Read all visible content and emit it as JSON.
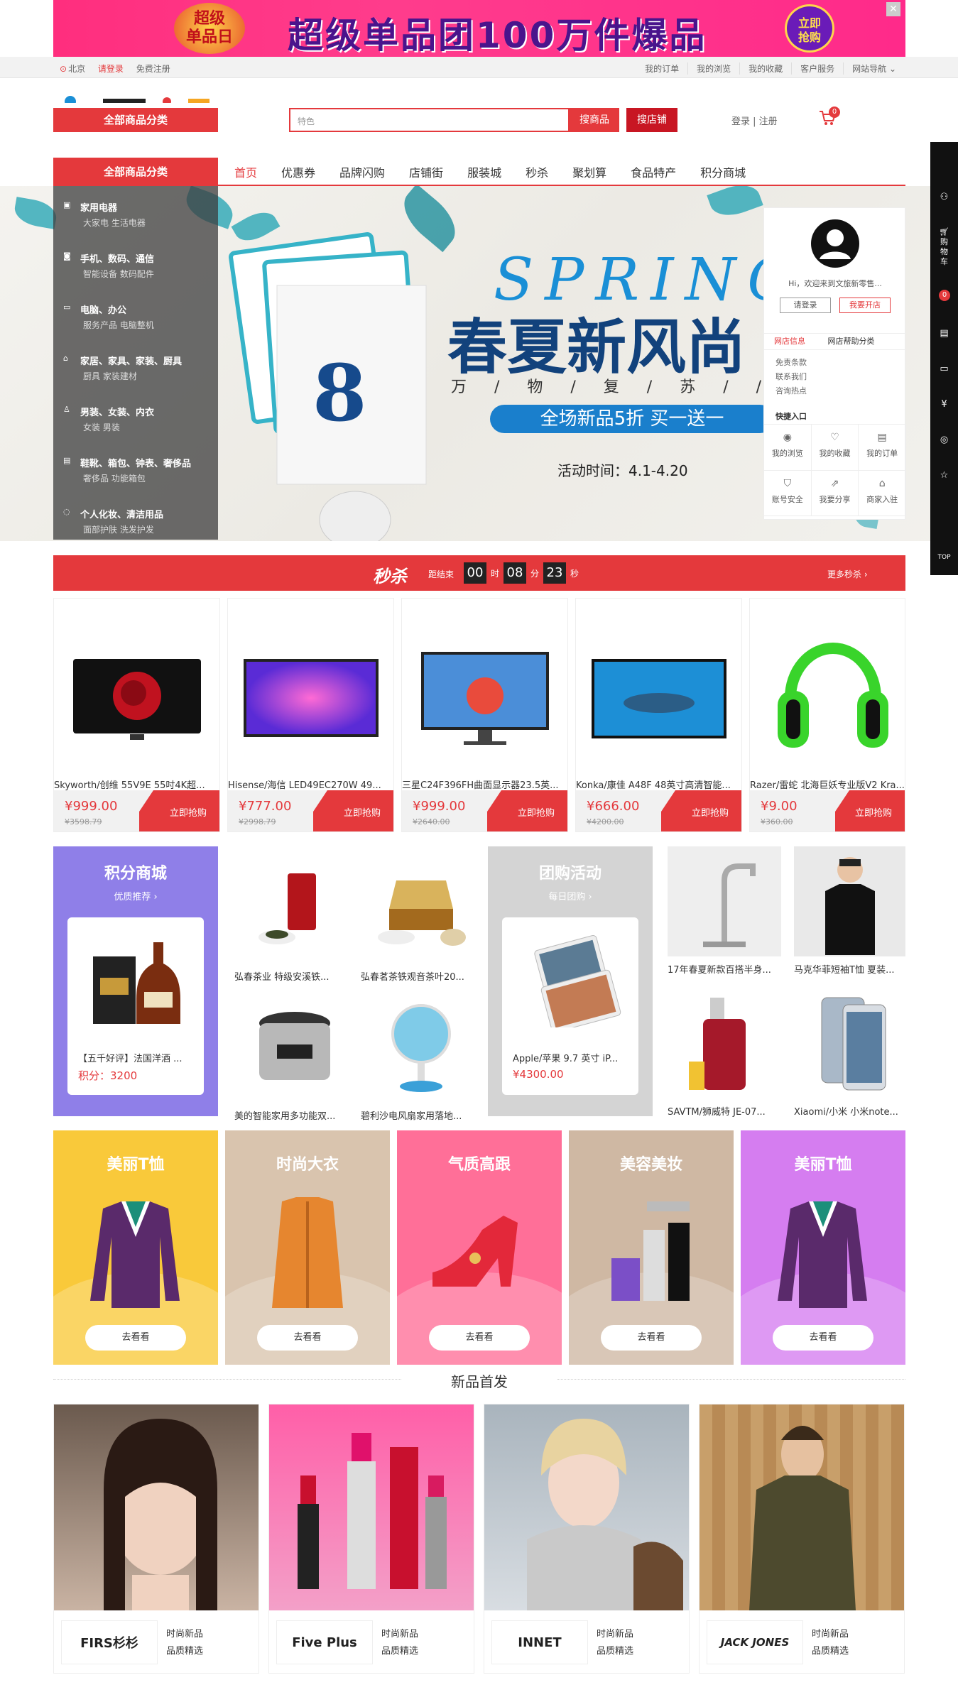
{
  "top_ad": {
    "badge_line1": "超级",
    "badge_line2": "单品日",
    "slogan": "超级单品团100万件爆品",
    "cta_line1": "立即",
    "cta_line2": "抢购",
    "close": "✕"
  },
  "toolbar": {
    "location": "北京",
    "login": "请登录",
    "register": "免费注册",
    "links": [
      "我的订单",
      "我的浏览",
      "我的收藏",
      "客户服务",
      "网站导航 ⌄"
    ]
  },
  "header": {
    "all_categories": "全部商品分类",
    "search_placeholder": "特色",
    "search_products": "搜商品",
    "search_shops": "搜店铺",
    "login_register": "登录 | 注册",
    "cart_count": "0"
  },
  "nav": {
    "all_categories": "全部商品分类",
    "links": [
      "首页",
      "优惠券",
      "品牌闪购",
      "店铺街",
      "服装城",
      "秒杀",
      "聚划算",
      "食品特产",
      "积分商城"
    ]
  },
  "categories": [
    {
      "title": "家用电器",
      "sub": "大家电  生活电器"
    },
    {
      "title": "手机、数码、通信",
      "sub": "智能设备  数码配件"
    },
    {
      "title": "电脑、办公",
      "sub": "服务产品  电脑整机"
    },
    {
      "title": "家居、家具、家装、厨具",
      "sub": "厨具  家装建材"
    },
    {
      "title": "男装、女装、内衣",
      "sub": "女装  男装"
    },
    {
      "title": "鞋靴、箱包、钟表、奢侈品",
      "sub": "奢侈品  功能箱包"
    },
    {
      "title": "个人化妆、清洁用品",
      "sub": "面部护肤  洗发护发"
    }
  ],
  "banner": {
    "spring": "SPRING",
    "title": "春夏新风尚",
    "subtitle": "万 / 物 / 复 / 苏 / / 的 季",
    "promo": "全场新品5折 买一送一",
    "date": "活动时间：4.1-4.20"
  },
  "user_card": {
    "greeting": "Hi，欢迎来到文旅新零售...",
    "login": "请登录",
    "open_shop": "我要开店",
    "tab1": "网店信息",
    "tab2": "网店帮助分类",
    "notices": [
      "免责条款",
      "联系我们",
      "咨询热点"
    ],
    "quick_title": "快捷入口",
    "quick": [
      "我的浏览",
      "我的收藏",
      "我的订单",
      "账号安全",
      "我要分享",
      "商家入驻"
    ]
  },
  "sidebar": {
    "cart": "购物车",
    "cart_count": "0",
    "top": "TOP"
  },
  "seckill": {
    "title": "秒杀",
    "countdown_label": "距结束",
    "hh": "00",
    "mm": "08",
    "ss": "23",
    "u_h": "时",
    "u_m": "分",
    "u_s": "秒",
    "more": "更多秒杀 ›"
  },
  "products": [
    {
      "name": "Skyworth/创维 55V9E 55吋4K超...",
      "price": "¥999.00",
      "old": "¥3598.79",
      "buy": "立即抢购"
    },
    {
      "name": "Hisense/海信 LED49EC270W 49...",
      "price": "¥777.00",
      "old": "¥2998.79",
      "buy": "立即抢购"
    },
    {
      "name": "三星C24F396FH曲面显示器23.5英...",
      "price": "¥999.00",
      "old": "¥2640.00",
      "buy": "立即抢购"
    },
    {
      "name": "Konka/康佳 A48F 48英寸高清智能...",
      "price": "¥666.00",
      "old": "¥4200.00",
      "buy": "立即抢购"
    },
    {
      "name": "Razer/雷蛇 北海巨妖专业版V2 Kra...",
      "price": "¥9.00",
      "old": "¥360.00",
      "buy": "立即抢购"
    }
  ],
  "points_mall": {
    "title": "积分商城",
    "sub": "优质推荐 ›",
    "item": "【五千好评】法国洋酒 ...",
    "value": "积分：3200"
  },
  "group_buy": {
    "title": "团购活动",
    "sub": "每日团购 ›",
    "item": "Apple/苹果 9.7 英寸 iP...",
    "value": "¥4300.00"
  },
  "grid_items": [
    "弘春茶业 特级安溪铁...",
    "弘春茗茶铁观音茶叶20...",
    "美的智能家用多功能双...",
    "碧利沙电风扇家用落地...",
    "17年春夏新款百搭半身...",
    "马克华菲短袖T恤 夏装...",
    "SAVTM/狮威特 JE-07...",
    "Xiaomi/小米 小米note..."
  ],
  "tiles": [
    {
      "title": "美丽T恤",
      "go": "去看看",
      "color": "#f9c93a"
    },
    {
      "title": "时尚大衣",
      "go": "去看看",
      "color": "#d9c4ae"
    },
    {
      "title": "气质高跟",
      "go": "去看看",
      "color": "#ff6f98"
    },
    {
      "title": "美容美妆",
      "go": "去看看",
      "color": "#cfb8a3"
    },
    {
      "title": "美丽T恤",
      "go": "去看看",
      "color": "#d57df0"
    }
  ],
  "new_arrivals": {
    "title": "新品首发",
    "items": [
      {
        "brand": "FIRS杉杉",
        "l1": "时尚新品",
        "l2": "品质精选"
      },
      {
        "brand": "Five Plus",
        "l1": "时尚新品",
        "l2": "品质精选"
      },
      {
        "brand": "INNET",
        "l1": "时尚新品",
        "l2": "品质精选"
      },
      {
        "brand": "JACK JONES",
        "l1": "时尚新品",
        "l2": "品质精选"
      }
    ]
  },
  "colors": {
    "accent": "#e4393c",
    "points": "#8f7fe8",
    "group": "#c9c9c9"
  }
}
